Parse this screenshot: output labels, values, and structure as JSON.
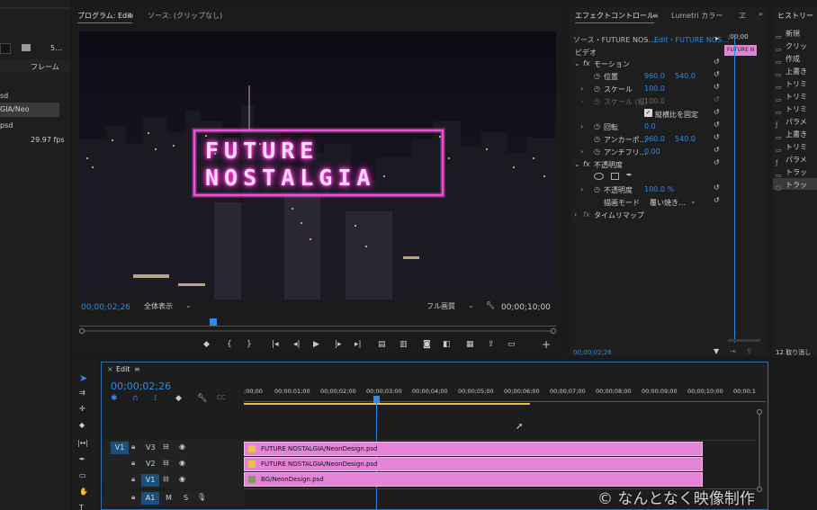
{
  "project_panel": {
    "rows": [
      "5…",
      "フレーム",
      "sd",
      "GIA/Neo",
      "psd",
      "29.97 fps"
    ]
  },
  "program_monitor": {
    "tab_program": "プログラム: Edit",
    "tab_source": "ソース: (クリップなし)",
    "timecode_current": "00;00;02;26",
    "zoom": "全体表示",
    "quality": "フル画質",
    "timecode_duration": "00;00;10;00",
    "neon_line1": "FUTURE",
    "neon_line2": "NOSTALGIA"
  },
  "effect_controls": {
    "tab_effect": "エフェクトコントロール",
    "tab_lumetri": "Lumetri カラー",
    "source_label": "ソース・FUTURE NOS…",
    "edit_label": "Edit・FUTURE NOS…",
    "mini_time": ";00;00",
    "mini_clip": "FUTURE N",
    "video_label": "ビデオ",
    "motion": "モーション",
    "position_label": "位置",
    "position_x": "960.0",
    "position_y": "540.0",
    "scale_label": "スケール",
    "scale_value": "100.0",
    "scale_w_label": "スケール (幅)",
    "scale_w_value": "100.0",
    "uniform_label": "縦横比を固定",
    "rotation_label": "回転",
    "rotation_value": "0.0",
    "anchor_label": "アンカーポ…",
    "anchor_x": "960.0",
    "anchor_y": "540.0",
    "antiflicker_label": "アンチフリ…",
    "antiflicker_value": "0.00",
    "opacity_section": "不透明度",
    "opacity_label": "不透明度",
    "opacity_value": "100.0 %",
    "blend_label": "描画モード",
    "blend_value": "覆い焼き…",
    "time_remap": "タイムリマップ",
    "footer_time": "00;00;02;26"
  },
  "history": {
    "title": "ヒストリー",
    "items": [
      "新規",
      "クリッ",
      "作成",
      "上書き",
      "トリミ",
      "トリミ",
      "トリミ",
      "パラメ",
      "上書き",
      "トリミ",
      "パラメ",
      "トラッ",
      "トラッ"
    ],
    "footer": "12 取り消し"
  },
  "timeline": {
    "tab": "Edit",
    "timecode": "00;00;02;26",
    "ruler": [
      ";00;00",
      "00;00;01;00",
      "00;00;02;00",
      "00;00;03;00",
      "00;00;04;00",
      "00;00;05;00",
      "00;00;06;00",
      "00;00;07;00",
      "00;00;08;00",
      "00;00;09;00",
      "00;00;10;00",
      "00;00;1"
    ],
    "tracks": {
      "v3": "V3",
      "v2": "V2",
      "v1": "V1",
      "v1_src": "V1",
      "a1": "A1",
      "a1_src": "A1",
      "m": "M",
      "s": "S"
    },
    "clips": {
      "v3": "FUTURE NOSTALGIA/NeonDesign.psd",
      "v2": "FUTURE NOSTALGIA/NeonDesign.psd",
      "v1": "BG/NeonDesign.psd"
    }
  },
  "watermark": "なんとなく映像制作",
  "colors": {
    "accent": "#2d8ceb",
    "clip": "#e384d9",
    "neon": "#ff2bd6"
  }
}
